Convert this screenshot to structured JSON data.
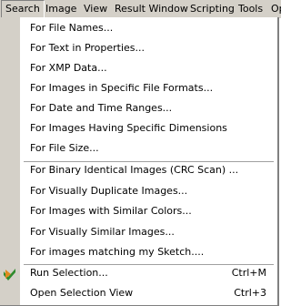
{
  "menubar": {
    "items": [
      "Search",
      "Image",
      "View",
      "Result Window",
      "Scripting",
      "Tools",
      "Op"
    ],
    "active": "Search"
  },
  "menu": {
    "items": [
      "For File Names...",
      "For Text in Properties...",
      "For XMP Data...",
      "For Images in Specific File Formats...",
      "For Date and Time Ranges...",
      "For Images Having Specific Dimensions",
      "For File Size...",
      "For Binary Identical Images (CRC Scan) ...",
      "For Visually Duplicate Images...",
      "For Images with Similar Colors...",
      "For Visually Similar Images...",
      "For images matching my Sketch....",
      "Run Selection...",
      "Open Selection View"
    ],
    "shortcuts": {
      "run_selection": "Ctrl+M",
      "open_selection_view": "Ctrl+3"
    },
    "icons": {
      "run_selection": "run-selection-icon"
    }
  },
  "colors": {
    "menubar_bg": "#d4d0c8",
    "menu_bg": "#ffffff",
    "separator": "#a0a0a0",
    "icon_green": "#2e8b2e",
    "icon_orange": "#e08a1e"
  }
}
